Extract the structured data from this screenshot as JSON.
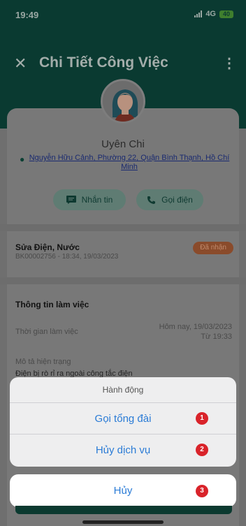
{
  "status_bar": {
    "time": "19:49",
    "network": "4G",
    "battery": "40"
  },
  "app_bar": {
    "title": "Chi Tiết Công Việc",
    "close_icon": "close-icon",
    "menu_icon": "more-vertical-icon"
  },
  "customer": {
    "name": "Uyên Chi",
    "address": "Nguyễn Hữu Cảnh, Phường 22, Quận Bình Thạnh, Hồ Chí Minh"
  },
  "actions": {
    "message_label": "Nhắn tin",
    "call_label": "Gọi điện"
  },
  "job": {
    "title": "Sửa Điện, Nước",
    "code": "BK00002756 - 18:34, 19/03/2023",
    "status": "Đã nhận"
  },
  "work_info": {
    "heading": "Thông tin làm việc",
    "time_label": "Thời gian làm việc",
    "time_value_line1": "Hôm nay, 19/03/2023",
    "time_value_line2": "Từ 19:33",
    "desc_label": "Mô tả hiện trạng",
    "desc_value": "Điện bị rò rỉ ra ngoài công tắc điện"
  },
  "action_sheet": {
    "title": "Hành động",
    "options": [
      {
        "label": "Gọi tổng đài",
        "marker": "1"
      },
      {
        "label": "Hủy dịch vụ",
        "marker": "2"
      }
    ],
    "cancel": {
      "label": "Hủy",
      "marker": "3"
    }
  },
  "colors": {
    "primary": "#0b4a3d",
    "link": "#2a7bd6",
    "marker": "#d9232a",
    "badge": "#e0733a"
  }
}
